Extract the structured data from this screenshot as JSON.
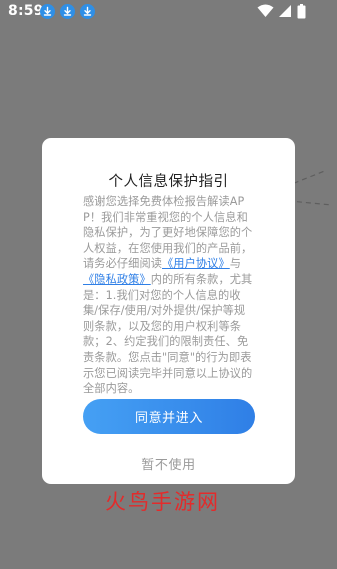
{
  "status_bar": {
    "time": "8:59",
    "notification_icons": [
      "download-icon",
      "download-icon",
      "download-icon"
    ],
    "system_icons": [
      "wifi-icon",
      "signal-icon",
      "battery-icon"
    ]
  },
  "dialog": {
    "title": "个人信息保护指引",
    "body_intro": "感谢您选择免费体检报告解读APP！我们非常重视您的个人信息和隐私保护，为了更好地保障您的个人权益，在您使用我们的产品前，请务必仔细阅读",
    "link_user_agreement": "《用户协议》",
    "connector": "与",
    "link_privacy_policy": "《隐私政策》",
    "body_rest": "内的所有条款，尤其是：1.我们对您的个人信息的收集/保存/使用/对外提供/保护等规则条款，以及您的用户权利等条款；2、约定我们的限制责任、免责条款。您点击\"同意\"的行为即表示您已阅读完毕并同意以上协议的全部内容。",
    "agree_button": "同意并进入",
    "disagree_button": "暂不使用"
  },
  "watermark": "火鸟手游网",
  "colors": {
    "overlay": "#7b7b7b",
    "accent": "#2f7fe6",
    "button_gradient_start": "#45a0f4",
    "button_gradient_end": "#2f7fe6",
    "watermark": "#e32b2b"
  }
}
